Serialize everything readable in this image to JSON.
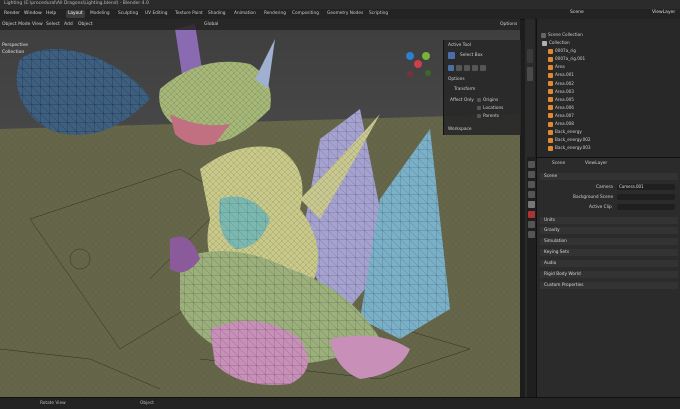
{
  "window_title": "Lighting (E:\\procedural\\All Dragons\\Lighting.blend) - Blender 4.0",
  "menu": [
    "Render",
    "Window",
    "Help"
  ],
  "workspaces": [
    {
      "label": "Layout",
      "active": true
    },
    {
      "label": "Modeling",
      "active": false
    },
    {
      "label": "Sculpting",
      "active": false
    },
    {
      "label": "UV Editing",
      "active": false
    },
    {
      "label": "Texture Paint",
      "active": false
    },
    {
      "label": "Shading",
      "active": false
    },
    {
      "label": "Animation",
      "active": false
    },
    {
      "label": "Rendering",
      "active": false
    },
    {
      "label": "Compositing",
      "active": false
    },
    {
      "label": "Geometry Nodes",
      "active": false
    },
    {
      "label": "Scripting",
      "active": false
    }
  ],
  "viewport_header": {
    "mode": "Object Mode",
    "menus": [
      "View",
      "Select",
      "Add",
      "Object"
    ],
    "orientation": "Global",
    "options": "Options"
  },
  "viewport_overlay": {
    "line1": "Perspective",
    "line2": "Collection"
  },
  "npanel": {
    "active_tool": "Active Tool",
    "select_box": "Select Box",
    "options": "Options",
    "transform": "Transform",
    "affect_only": "Affect Only",
    "origins": "Origins",
    "locations": "Locations",
    "parents": "Parents",
    "workspace": "Workspace"
  },
  "topright": {
    "scene": "Scene",
    "view_layer": "ViewLayer"
  },
  "outliner": {
    "root": "Scene Collection",
    "items": [
      {
        "label": "Collection",
        "color": "#b0b0b0"
      },
      {
        "label": "0007a_rig",
        "color": "#e08a2f"
      },
      {
        "label": "0007a_rig.001",
        "color": "#e08a2f"
      },
      {
        "label": "Area",
        "color": "#e08a2f"
      },
      {
        "label": "Area.001",
        "color": "#e08a2f"
      },
      {
        "label": "Area.002",
        "color": "#e08a2f"
      },
      {
        "label": "Area.003",
        "color": "#e08a2f"
      },
      {
        "label": "Area.005",
        "color": "#e08a2f"
      },
      {
        "label": "Area.006",
        "color": "#e08a2f"
      },
      {
        "label": "Area.007",
        "color": "#e08a2f"
      },
      {
        "label": "Area.008",
        "color": "#e08a2f"
      },
      {
        "label": "Back_energy",
        "color": "#e08a2f"
      },
      {
        "label": "Back_energy.002",
        "color": "#e08a2f"
      },
      {
        "label": "Back_energy.003",
        "color": "#e08a2f"
      }
    ]
  },
  "properties": {
    "scene": "Scene",
    "view_layer": "ViewLayer",
    "scene_panel": "Scene",
    "camera_label": "Camera",
    "camera_value": "Camera.001",
    "background_scene": "Background Scene",
    "active_clip": "Active Clip",
    "panels": [
      "Units",
      "Gravity",
      "Simulation",
      "Keying Sets",
      "Audio",
      "Rigid Body World",
      "Custom Properties"
    ]
  },
  "statusbar": {
    "rotate": "Rotate View",
    "object": "Object"
  }
}
